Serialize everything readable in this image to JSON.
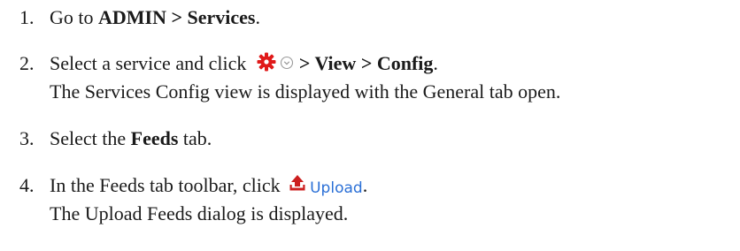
{
  "steps": [
    {
      "number": "1.",
      "text_before": "Go to ",
      "bold": "ADMIN > Services",
      "text_after": "."
    },
    {
      "number": "2.",
      "text_before": "Select a service and click ",
      "bold": "> View > Config",
      "text_after": ".",
      "icons": [
        "gear-icon",
        "dropdown-circle-icon"
      ],
      "note": "The Services Config view is displayed with the General tab open."
    },
    {
      "number": "3.",
      "text_before": "Select the ",
      "bold": "Feeds",
      "text_after": " tab."
    },
    {
      "number": "4.",
      "text_before": "In the Feeds tab toolbar, click ",
      "button_label": "Upload",
      "button_icon": "upload-icon",
      "text_after": ".",
      "note": "The Upload Feeds dialog is displayed."
    }
  ],
  "colors": {
    "gear": "#e01a1a",
    "link": "#2a6fd6",
    "upload_icon": "#cc1f1f",
    "text": "#1a1a1a"
  }
}
